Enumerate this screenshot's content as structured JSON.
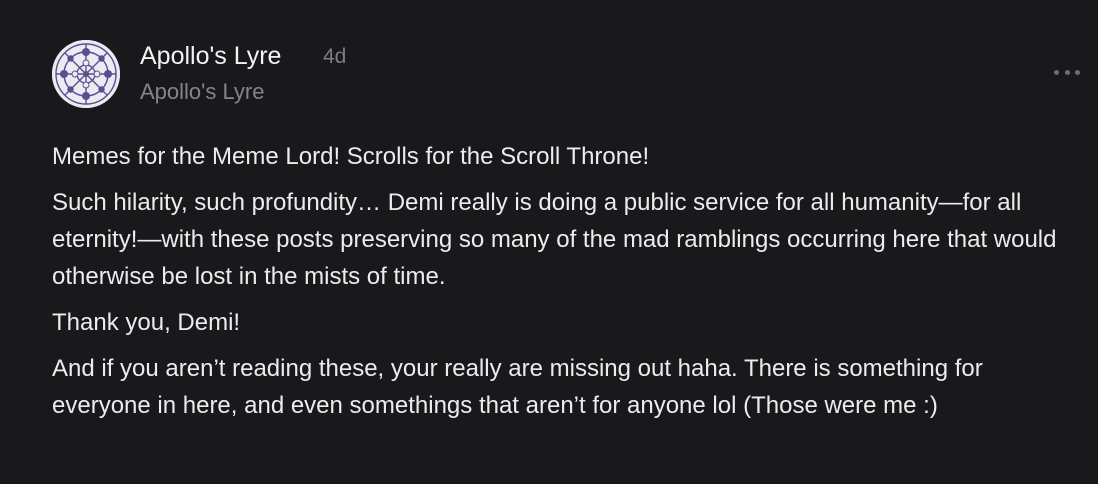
{
  "comment": {
    "author": "Apollo's Lyre",
    "timestamp": "4d",
    "publication": "Apollo's Lyre",
    "more_icon": "ellipsis-horizontal-icon",
    "avatar_icon": "ornamental-pattern-avatar",
    "paragraphs": [
      "Memes for the Meme Lord! Scrolls for the Scroll Throne!",
      "Such hilarity, such profundity… Demi really is doing a public service for all humanity—for all eternity!—with these posts preserving so many of the mad ramblings occurring here that would otherwise be lost in the mists of time.",
      "Thank you, Demi!",
      "And if you aren’t reading these, your really are missing out haha. There is something for everyone in here, and even somethings that aren’t for anyone lol (Those were me :)"
    ]
  },
  "colors": {
    "background": "#19191b",
    "text": "#ececee",
    "muted": "#84848a",
    "avatar_ink": "#5a4f8e"
  }
}
